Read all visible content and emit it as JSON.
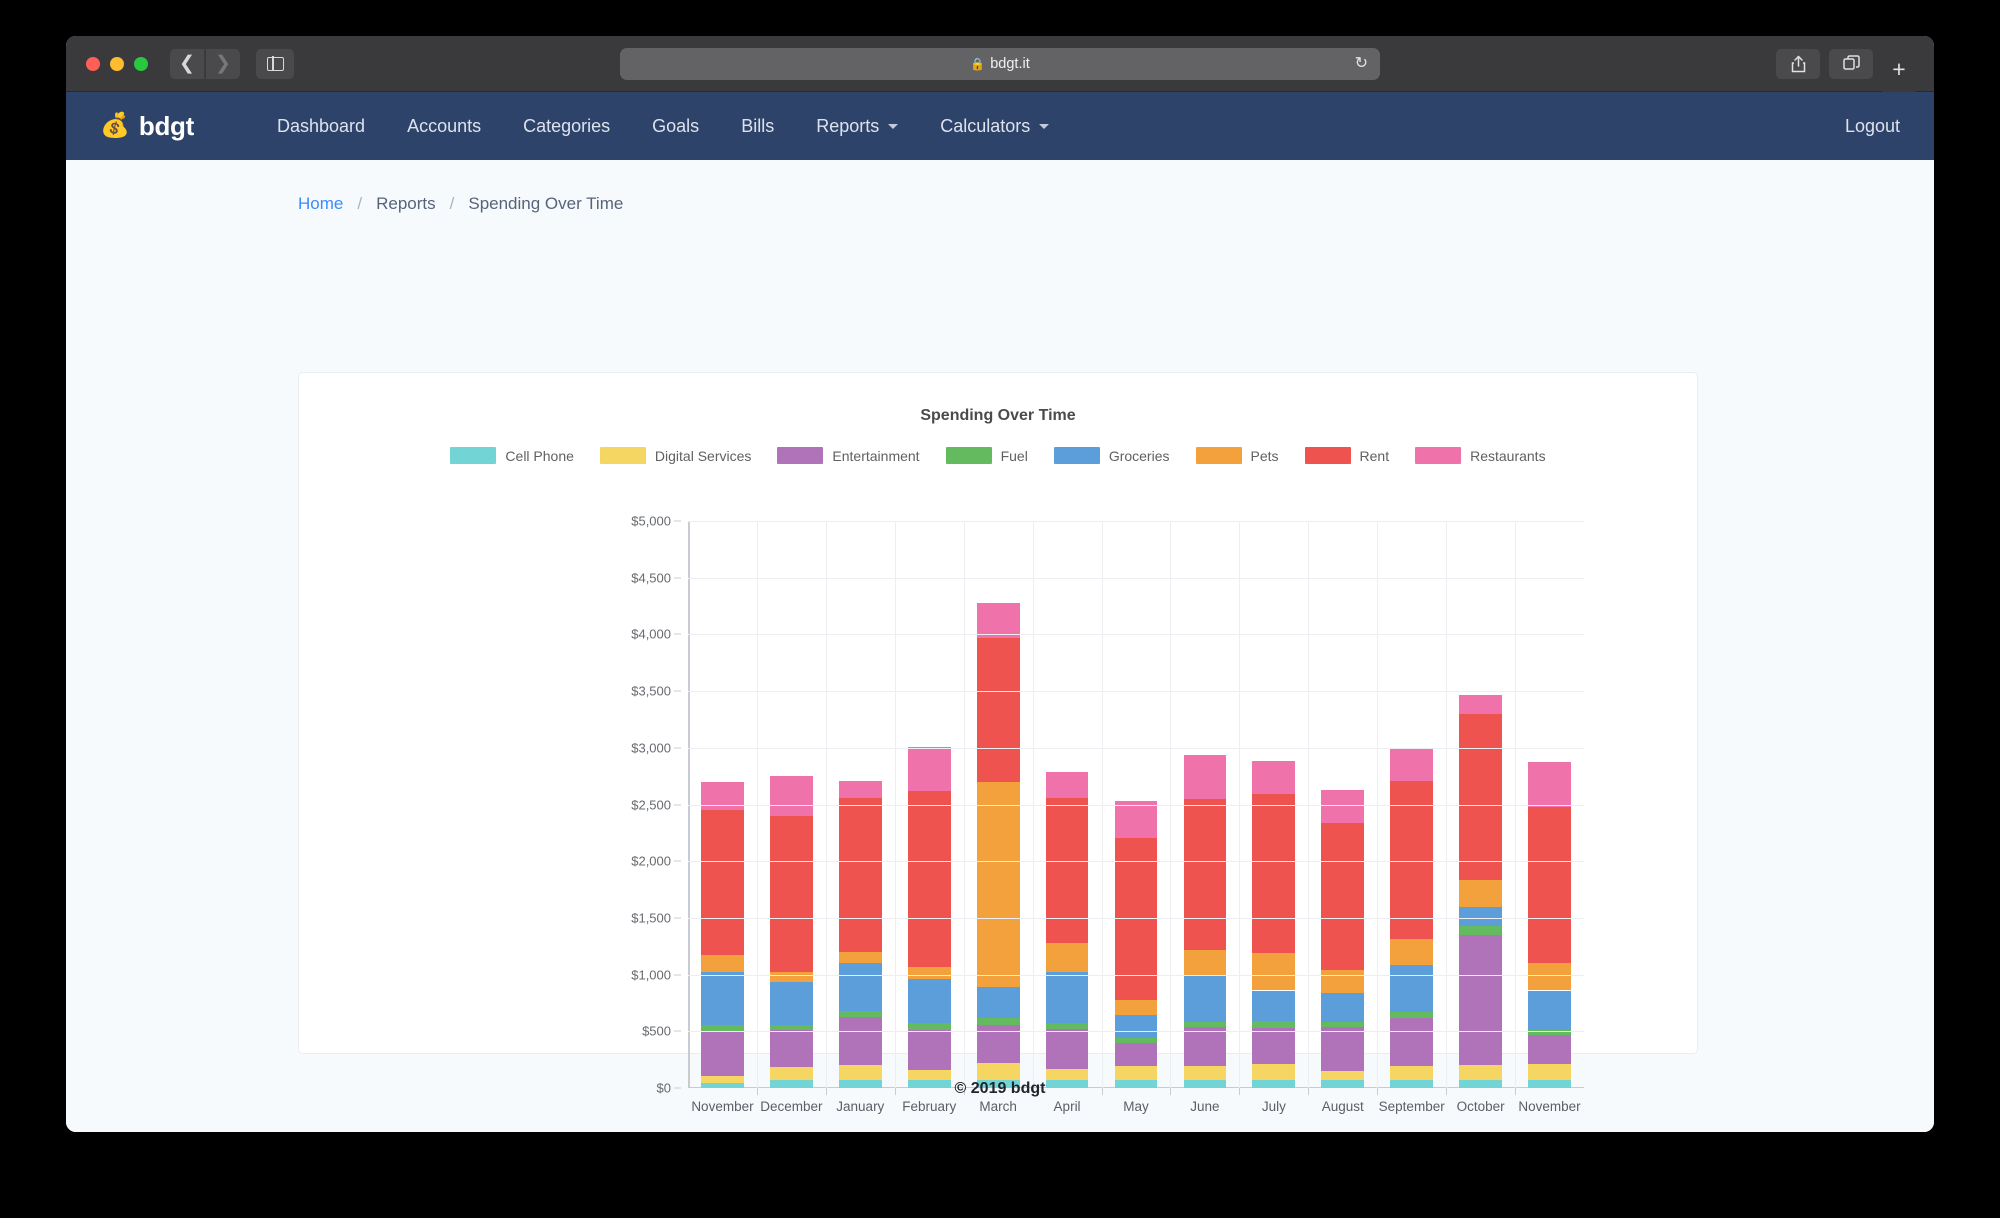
{
  "browser": {
    "url": "bdgt.it",
    "lock_icon": "lock-icon",
    "back_icon": "chevron-left-icon",
    "forward_icon": "chevron-right-icon",
    "sidebar_icon": "sidebar-toggle-icon",
    "reload_icon": "reload-icon",
    "share_icon": "share-icon",
    "tabs_icon": "show-tabs-icon",
    "new_tab_label": "+"
  },
  "navbar": {
    "brand_icon": "money-bag-icon",
    "brand": "bdgt",
    "items": [
      {
        "label": "Dashboard",
        "dropdown": false
      },
      {
        "label": "Accounts",
        "dropdown": false
      },
      {
        "label": "Categories",
        "dropdown": false
      },
      {
        "label": "Goals",
        "dropdown": false
      },
      {
        "label": "Bills",
        "dropdown": false
      },
      {
        "label": "Reports",
        "dropdown": true
      },
      {
        "label": "Calculators",
        "dropdown": true
      }
    ],
    "logout": "Logout"
  },
  "breadcrumb": {
    "home": "Home",
    "sep1": "/",
    "reports": "Reports",
    "sep2": "/",
    "current": "Spending Over Time"
  },
  "footer": {
    "copyright": "© 2019 bdgt"
  },
  "chart_data": {
    "type": "bar",
    "stacked": true,
    "title": "Spending Over Time",
    "xlabel": "",
    "ylabel": "",
    "ylim": [
      0,
      5000
    ],
    "ytick_values": [
      0,
      500,
      1000,
      1500,
      2000,
      2500,
      3000,
      3500,
      4000,
      4500,
      5000
    ],
    "ytick_labels": [
      "$0",
      "$500",
      "$1,000",
      "$1,500",
      "$2,000",
      "$2,500",
      "$3,000",
      "$3,500",
      "$4,000",
      "$4,500",
      "$5,000"
    ],
    "grid": true,
    "legend_position": "top",
    "categories": [
      "November",
      "December",
      "January",
      "February",
      "March",
      "April",
      "May",
      "June",
      "July",
      "August",
      "September",
      "October",
      "November"
    ],
    "series": [
      {
        "name": "Cell Phone",
        "color": "#73d4d6",
        "values": [
          45,
          75,
          70,
          70,
          75,
          70,
          75,
          75,
          75,
          70,
          75,
          75,
          75
        ]
      },
      {
        "name": "Digital Services",
        "color": "#f6d662",
        "values": [
          65,
          110,
          135,
          85,
          150,
          100,
          120,
          120,
          135,
          80,
          120,
          125,
          140
        ]
      },
      {
        "name": "Entertainment",
        "color": "#b072b8",
        "values": [
          390,
          325,
          425,
          360,
          330,
          350,
          200,
          340,
          320,
          385,
          420,
          1150,
          250
        ]
      },
      {
        "name": "Fuel",
        "color": "#64bb5f",
        "values": [
          55,
          50,
          45,
          55,
          60,
          55,
          45,
          50,
          60,
          45,
          55,
          75,
          50
        ]
      },
      {
        "name": "Groceries",
        "color": "#5b9ed9",
        "values": [
          465,
          375,
          425,
          395,
          280,
          450,
          200,
          400,
          270,
          260,
          415,
          175,
          345
        ]
      },
      {
        "name": "Pets",
        "color": "#f2a13c",
        "values": [
          150,
          85,
          100,
          100,
          1800,
          255,
          140,
          230,
          330,
          200,
          225,
          235,
          240
        ]
      },
      {
        "name": "Rent",
        "color": "#ef5350",
        "values": [
          1280,
          1375,
          1360,
          1550,
          1275,
          1275,
          1425,
          1330,
          1400,
          1300,
          1400,
          1460,
          1375
        ]
      },
      {
        "name": "Restaurants",
        "color": "#ef72ab",
        "values": [
          250,
          355,
          145,
          390,
          310,
          235,
          330,
          395,
          290,
          290,
          285,
          175,
          400
        ]
      }
    ],
    "totals": [
      2700,
      2750,
      2705,
      3005,
      4280,
      2790,
      2535,
      2940,
      2880,
      2630,
      2995,
      3470,
      2875
    ]
  }
}
